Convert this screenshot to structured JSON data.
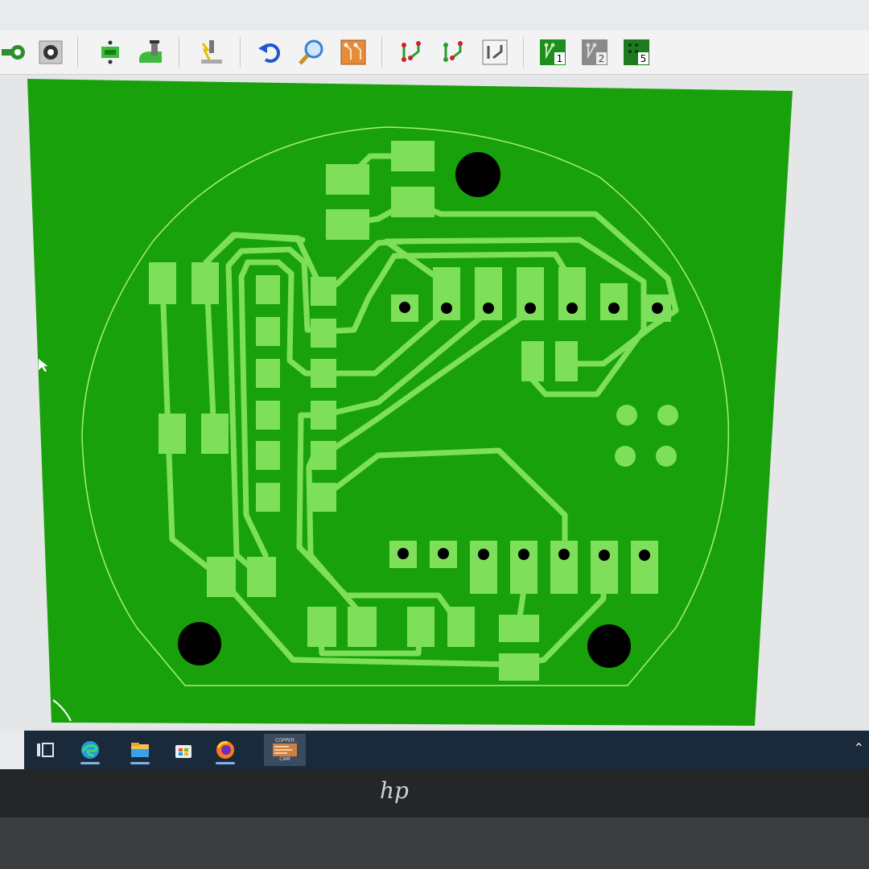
{
  "toolbar": {
    "groups": [
      [
        "track-tool-icon",
        "pad-tool-icon"
      ],
      [
        "smd-pad-icon",
        "via-tool-icon"
      ],
      [
        "drc-check-icon"
      ],
      [
        "undo-icon",
        "zoom-icon",
        "copper-board-icon"
      ],
      [
        "route-net-icon",
        "route-net-alt-icon",
        "route-board-icon"
      ],
      [
        "layer-1-icon",
        "layer-2-icon",
        "layer-5-icon"
      ]
    ],
    "layer_labels": [
      "1",
      "2",
      "5"
    ]
  },
  "board": {
    "copper_color": "#19a10b",
    "track_color": "#7ee05a",
    "outline_color": "#a6f07a",
    "hole_color": "#000000"
  },
  "taskbar": {
    "items": [
      "task-view-icon",
      "edge-icon",
      "file-explorer-icon",
      "store-icon",
      "firefox-icon",
      "coppercam-icon"
    ],
    "app_tile_text": [
      "COPPER",
      "CAM"
    ]
  },
  "bezel": {
    "logo_text": "hp"
  }
}
